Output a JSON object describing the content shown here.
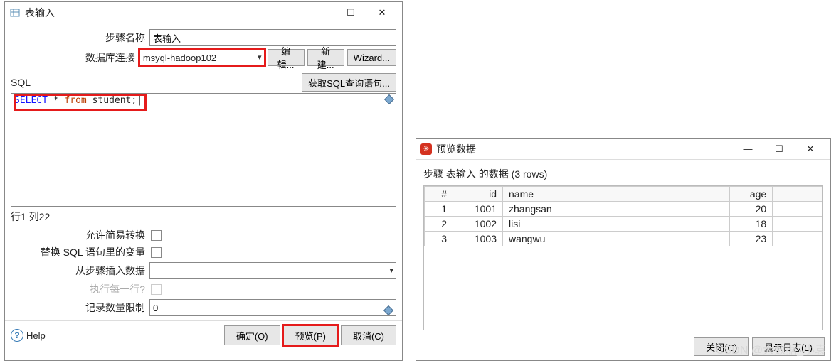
{
  "dialog1": {
    "title": "表输入",
    "step_name_label": "步骤名称",
    "step_name_value": "表输入",
    "db_conn_label": "数据库连接",
    "db_conn_value": "msyql-hadoop102",
    "edit_btn": "编辑...",
    "new_btn": "新建...",
    "wizard_btn": "Wizard...",
    "sql_label": "SQL",
    "get_sql_btn": "获取SQL查询语句...",
    "sql_tokens": {
      "select": "SELECT",
      "star": "*",
      "from": "from",
      "rest": "student;"
    },
    "status": "行1 列22",
    "allow_simple_label": "允许简易转换",
    "replace_vars_label": "替换 SQL 语句里的变量",
    "insert_from_step_label": "从步骤插入数据",
    "insert_from_step_value": "",
    "exec_each_row_label": "执行每一行?",
    "record_limit_label": "记录数量限制",
    "record_limit_value": "0",
    "help_label": "Help",
    "ok_btn": "确定(O)",
    "preview_btn": "预览(P)",
    "cancel_btn": "取消(C)"
  },
  "dialog2": {
    "title": "预览数据",
    "caption": "步骤 表输入 的数据  (3 rows)",
    "columns": [
      "#",
      "id",
      "name",
      "age"
    ],
    "rows": [
      {
        "n": "1",
        "id": "1001",
        "name": "zhangsan",
        "age": "20"
      },
      {
        "n": "2",
        "id": "1002",
        "name": "lisi",
        "age": "18"
      },
      {
        "n": "3",
        "id": "1003",
        "name": "wangwu",
        "age": "23"
      }
    ],
    "close_btn": "关闭(C)",
    "showlog_btn": "显示日志(L)"
  },
  "watermark": "CSDN @大数据_小袁"
}
